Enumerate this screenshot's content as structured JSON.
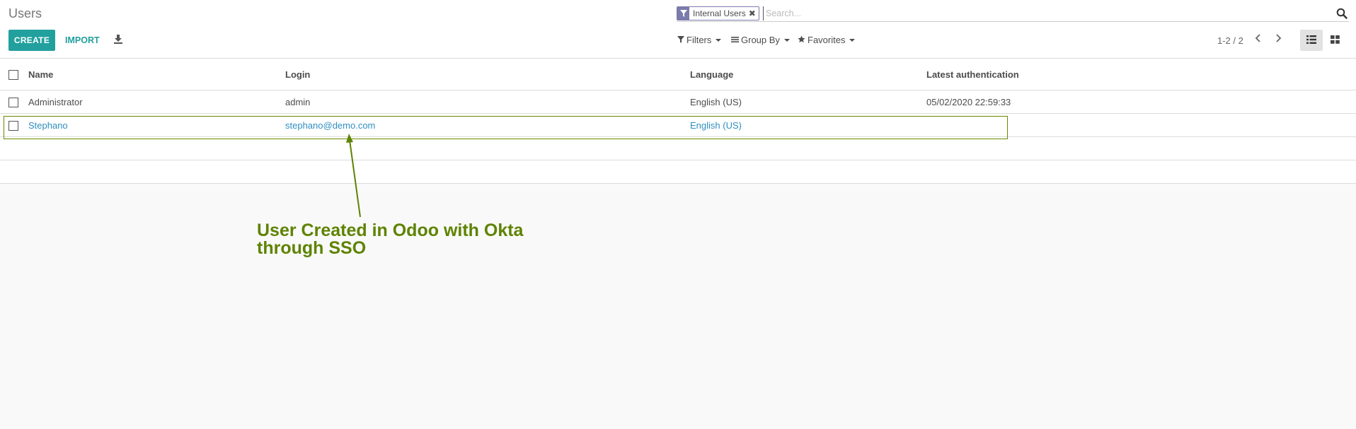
{
  "breadcrumb": {
    "title": "Users"
  },
  "buttons": {
    "create": "CREATE",
    "import": "IMPORT"
  },
  "icons": {
    "download": "download-icon",
    "filter": "filter-icon",
    "search": "search-icon",
    "list_view": "list-view-icon",
    "kanban_view": "kanban-view-icon"
  },
  "search": {
    "facet_label": "Internal Users",
    "facet_remove": "✖",
    "placeholder": "Search..."
  },
  "toolbar": {
    "filters": "Filters",
    "group_by": "Group By",
    "favorites": "Favorites"
  },
  "pager": {
    "value": "1-2 / 2"
  },
  "table": {
    "columns": [
      "Name",
      "Login",
      "Language",
      "Latest authentication"
    ],
    "rows": [
      {
        "name": "Administrator",
        "login": "admin",
        "language": "English (US)",
        "latest_auth": "05/02/2020 22:59:33"
      },
      {
        "name": "Stephano",
        "login": "stephano@demo.com",
        "language": "English (US)",
        "latest_auth": ""
      }
    ]
  },
  "annotation": {
    "text": "User Created in Odoo with Okta through SSO"
  },
  "colors": {
    "accent": "#21a09e",
    "facet": "#7c7bad",
    "annotation": "#5e8300",
    "link": "#2f8fbf"
  }
}
